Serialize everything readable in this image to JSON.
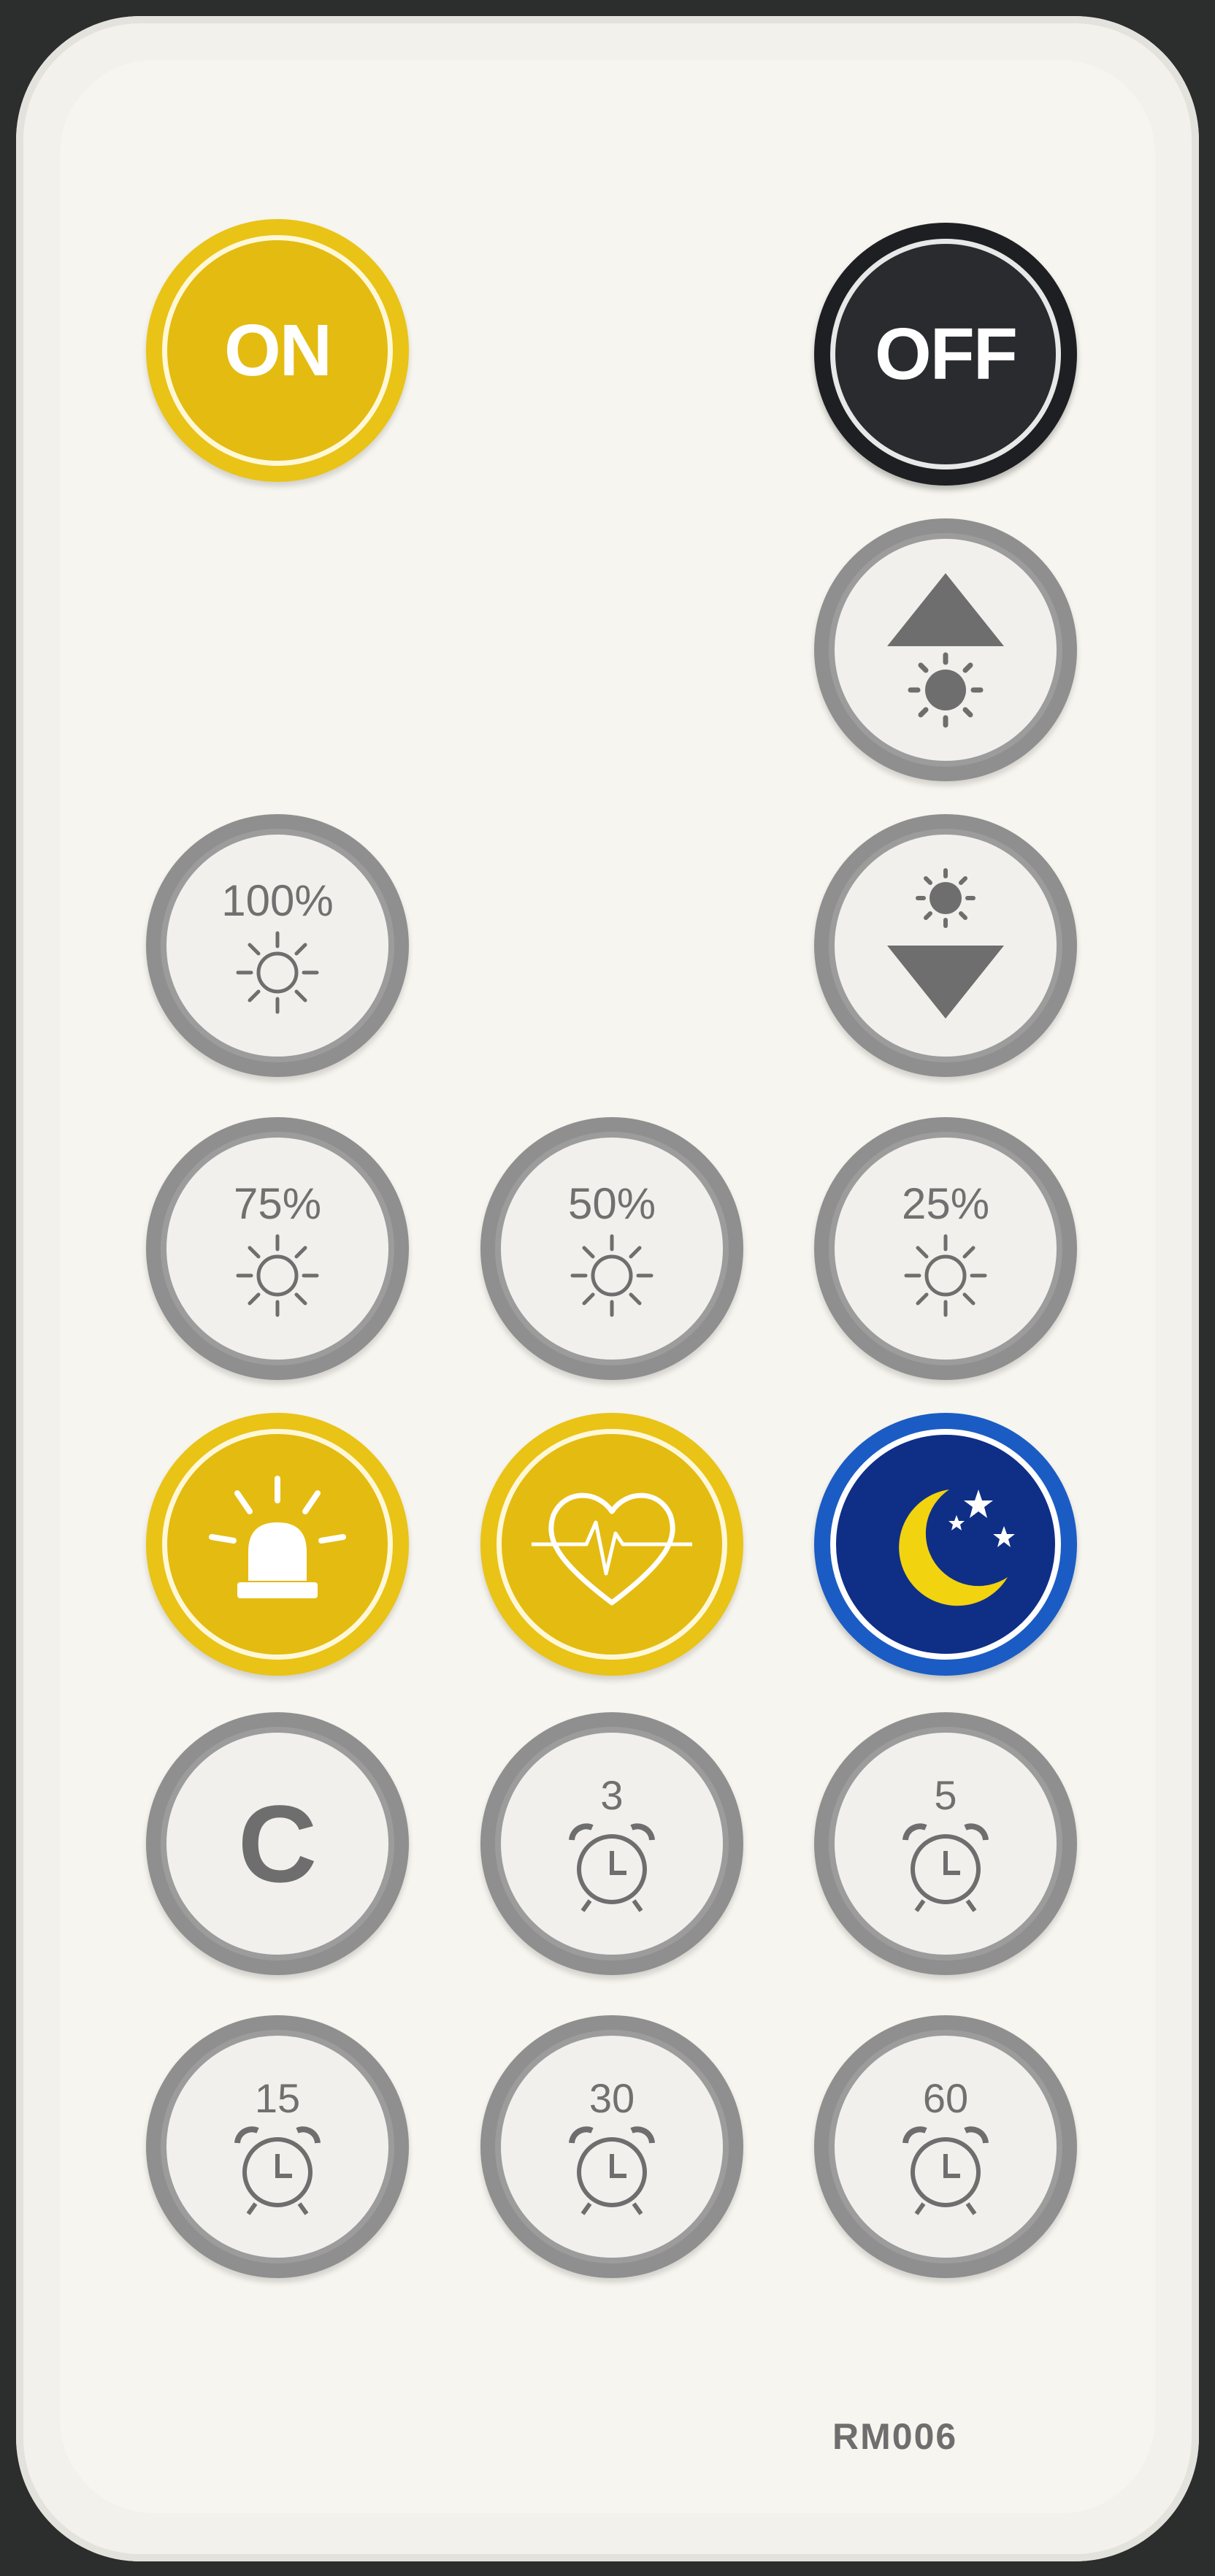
{
  "remote": {
    "model": "RM006",
    "colors": {
      "body": "#f3f1ec",
      "yellow": "#e9c316",
      "black": "#1e1f22",
      "blue": "#1a5cc4",
      "grey_ring": "#9c9c9c"
    }
  },
  "buttons": {
    "on": {
      "label": "ON",
      "icon": "power-on"
    },
    "off": {
      "label": "OFF",
      "icon": "power-off"
    },
    "brightness_up": {
      "icon": "brightness-up-icon"
    },
    "brightness_down": {
      "icon": "brightness-down-icon"
    },
    "b100": {
      "label": "100%",
      "icon": "sun-icon"
    },
    "b75": {
      "label": "75%",
      "icon": "sun-icon"
    },
    "b50": {
      "label": "50%",
      "icon": "sun-icon"
    },
    "b25": {
      "label": "25%",
      "icon": "sun-icon"
    },
    "alarm": {
      "icon": "siren-icon"
    },
    "heartbeat": {
      "icon": "heartbeat-icon"
    },
    "night": {
      "icon": "moon-stars-icon"
    },
    "cancel": {
      "label": "C"
    },
    "t3": {
      "label": "3",
      "icon": "alarm-clock-icon"
    },
    "t5": {
      "label": "5",
      "icon": "alarm-clock-icon"
    },
    "t15": {
      "label": "15",
      "icon": "alarm-clock-icon"
    },
    "t30": {
      "label": "30",
      "icon": "alarm-clock-icon"
    },
    "t60": {
      "label": "60",
      "icon": "alarm-clock-icon"
    }
  }
}
